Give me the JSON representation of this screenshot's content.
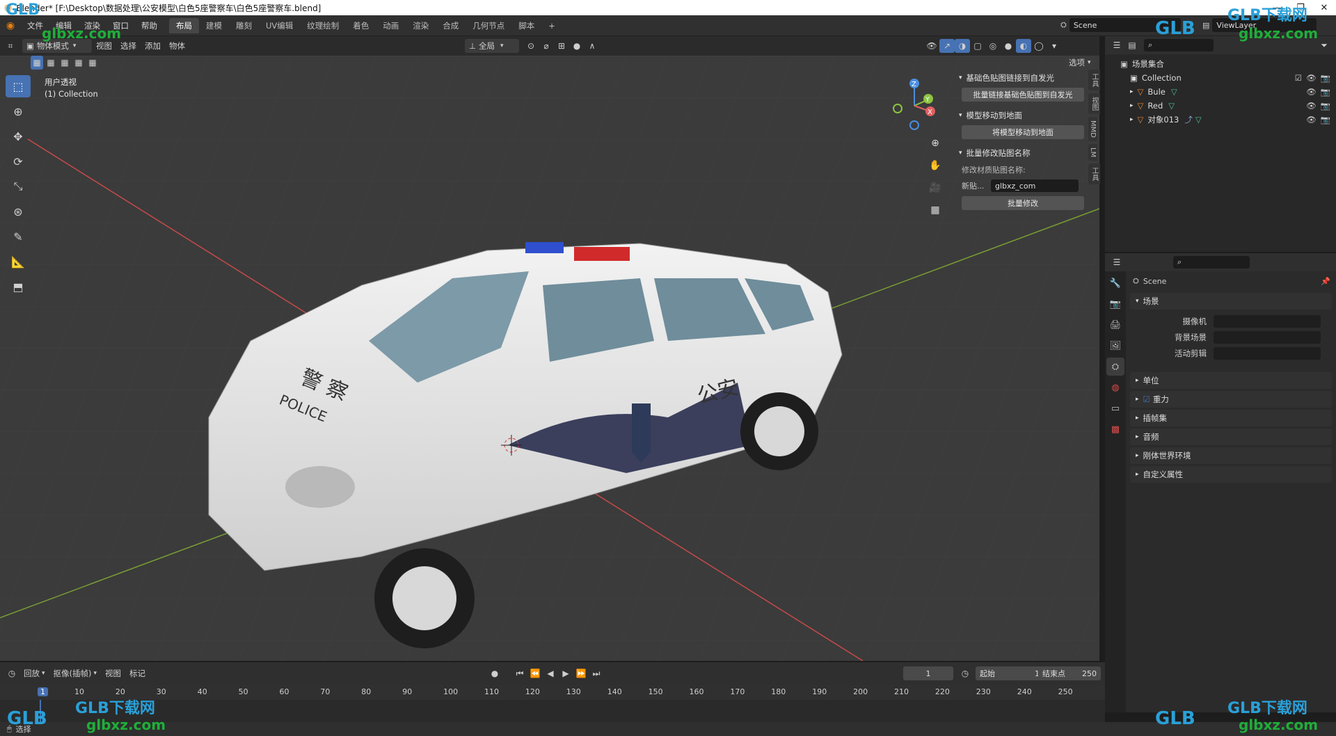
{
  "window": {
    "title": "Blender* [F:\\Desktop\\数据处理\\公安模型\\白色5座警察车\\白色5座警察车.blend]",
    "minimize": "—",
    "restore": "❐",
    "close": "✕"
  },
  "menu": [
    "文件",
    "编辑",
    "渲染",
    "窗口",
    "帮助"
  ],
  "workspace_tabs": [
    "布局",
    "建模",
    "雕刻",
    "UV编辑",
    "纹理绘制",
    "着色",
    "动画",
    "渲染",
    "合成",
    "几何节点",
    "脚本"
  ],
  "active_workspace": "布局",
  "add_tab": "+",
  "scene": {
    "name": "Scene",
    "view_layer": "ViewLayer"
  },
  "viewport_header": {
    "mode": "物体模式",
    "menus": [
      "视图",
      "选择",
      "添加",
      "物体"
    ],
    "transform_orientation": "全局",
    "options": "选项"
  },
  "viewport": {
    "view_name": "用户透视",
    "collection": "(1) Collection",
    "gizmo_axes": [
      "Z",
      "Y",
      "X"
    ]
  },
  "npanel": {
    "sections": [
      {
        "title": "基础色贴图链接到自发光",
        "button": "批量链接基础色贴图到自发光"
      },
      {
        "title": "模型移动到地面",
        "button": "将模型移动到地面"
      },
      {
        "title": "批量修改贴图名称",
        "label": "修改材质贴图名称:",
        "field_label": "新贴...",
        "field_value": "glbxz_com",
        "button": "批量修改"
      }
    ],
    "tabs": [
      "工具",
      "视图",
      "MMD",
      "LM",
      "工具"
    ]
  },
  "outliner": {
    "root": "场景集合",
    "items": [
      {
        "name": "Collection"
      },
      {
        "name": "Bule"
      },
      {
        "name": "Red"
      },
      {
        "name": "对象013"
      }
    ]
  },
  "properties": {
    "scene_name": "Scene",
    "section": "场景",
    "fields": [
      "摄像机",
      "背景场景",
      "活动剪辑"
    ],
    "subsections": [
      "单位",
      "重力",
      "插帧集",
      "音频",
      "刚体世界环境",
      "自定义属性"
    ]
  },
  "timeline": {
    "menus": [
      "回放",
      "抠像(插帧)",
      "视图",
      "标记"
    ],
    "current_frame": "1",
    "start_label": "起始",
    "start": "1",
    "end_label": "结束点",
    "end": "250",
    "ruler": [
      "1",
      "10",
      "20",
      "30",
      "40",
      "50",
      "60",
      "70",
      "80",
      "90",
      "100",
      "110",
      "120",
      "130",
      "140",
      "150",
      "160",
      "170",
      "180",
      "190",
      "200",
      "210",
      "220",
      "230",
      "240",
      "250"
    ]
  },
  "car_decals": {
    "hood_cn": "警 察",
    "hood_en": "POLICE",
    "door": "公安"
  },
  "watermark": {
    "brand": "GLB",
    "cn": "GLB下载网",
    "url": "glbxz.com"
  },
  "status": {
    "left": "选择"
  },
  "colors": {
    "accent": "#4772b3",
    "header": "#303030",
    "viewport": "#3b3b3b",
    "x_axis": "#e06060",
    "y_axis": "#8cc440",
    "z_axis": "#4a8fe0"
  }
}
